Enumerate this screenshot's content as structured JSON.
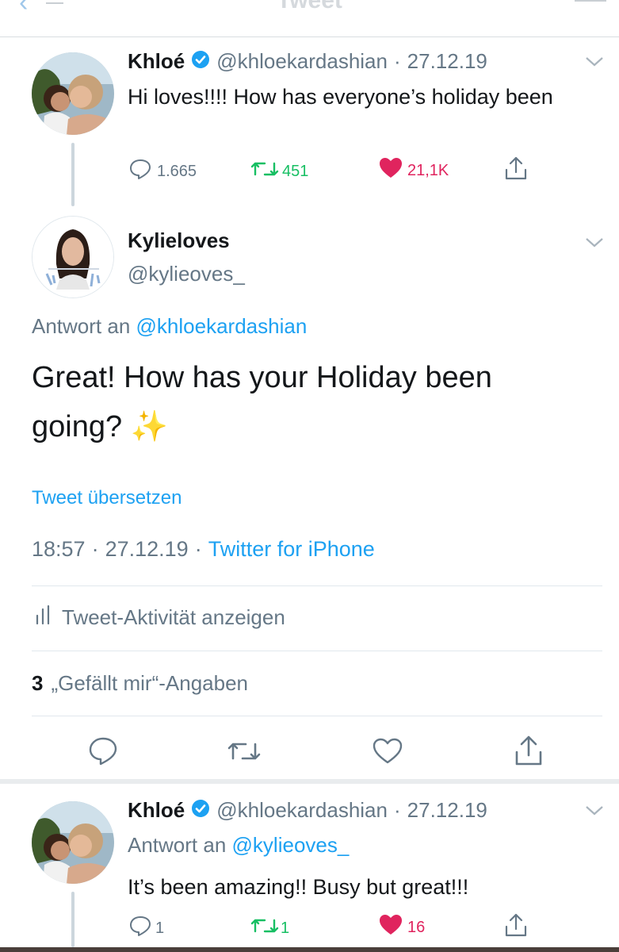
{
  "nav": {
    "title": "Tweet",
    "back_label": ""
  },
  "tweets": [
    {
      "author": "Khloé",
      "verified": true,
      "handle": "@khloekardashian",
      "date": "27.12.19",
      "separator": "·",
      "text": "Hi loves!!!! How has everyone’s holiday been",
      "replies": "1.665",
      "retweets": "451",
      "likes": "21,1K",
      "liked": true
    }
  ],
  "main_tweet": {
    "author": "Kylieloves",
    "handle": "@kylieoves_",
    "reply_prefix": "Antwort an",
    "reply_to": "@khloekardashian",
    "text": "Great! How has your Holiday been going?",
    "emoji": "✨",
    "translate": "Tweet übersetzen",
    "time": "18:57",
    "date": "27.12.19",
    "separator": "·",
    "source": "Twitter for iPhone",
    "activity_label": "Tweet-Aktivität anzeigen",
    "likes_count": "3",
    "likes_label": "„Gefällt mir“-Angaben"
  },
  "reply_tweet": {
    "author": "Khloé",
    "verified": true,
    "handle": "@khloekardashian",
    "date": "27.12.19",
    "separator": "·",
    "reply_prefix": "Antwort an",
    "reply_to": "@kylieoves_",
    "text": "It’s been amazing!! Busy but great!!!",
    "replies": "1",
    "retweets": "1",
    "likes": "16",
    "liked": true
  },
  "colors": {
    "accent": "#1da1f2",
    "retweet_green": "#17bf63",
    "like_red": "#e0245e",
    "secondary_text": "#657786"
  },
  "icons": [
    "back-chevron-icon",
    "verified-badge-icon",
    "chevron-down-icon",
    "reply-icon",
    "retweet-icon",
    "heart-icon",
    "share-icon",
    "activity-bars-icon"
  ]
}
